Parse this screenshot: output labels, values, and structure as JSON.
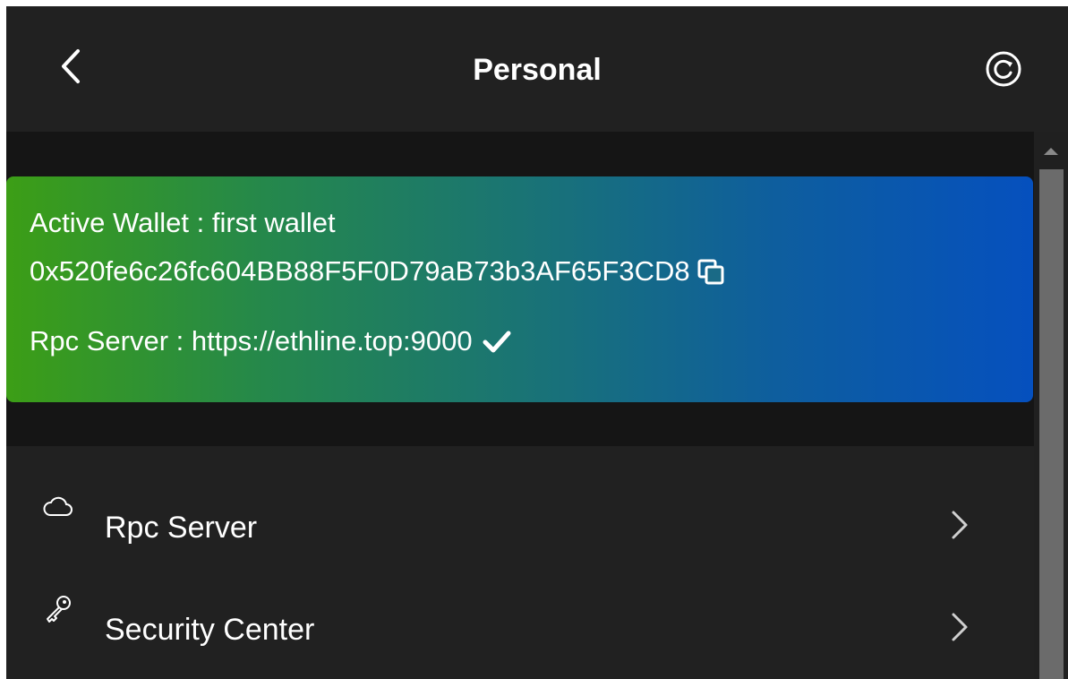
{
  "header": {
    "title": "Personal",
    "back_icon": "chevron-left-icon",
    "refresh_icon": "refresh-icon"
  },
  "wallet_card": {
    "active_wallet_text": "Active Wallet : first wallet",
    "address": "0x520fe6c26fc604BB88F5F0D79aB73b3AF65F3CD8",
    "rpc_text": "Rpc Server : https://ethline.top:9000",
    "copy_icon": "copy-icon",
    "status_icon": "check-icon",
    "gradient_start": "#3c9e16",
    "gradient_end": "#0550be"
  },
  "menu": {
    "items": [
      {
        "label": "Rpc Server",
        "icon": "cloud-icon"
      },
      {
        "label": "Security Center",
        "icon": "key-icon"
      }
    ]
  },
  "colors": {
    "background": "#151515",
    "panel": "#212121",
    "text": "#ffffff"
  }
}
